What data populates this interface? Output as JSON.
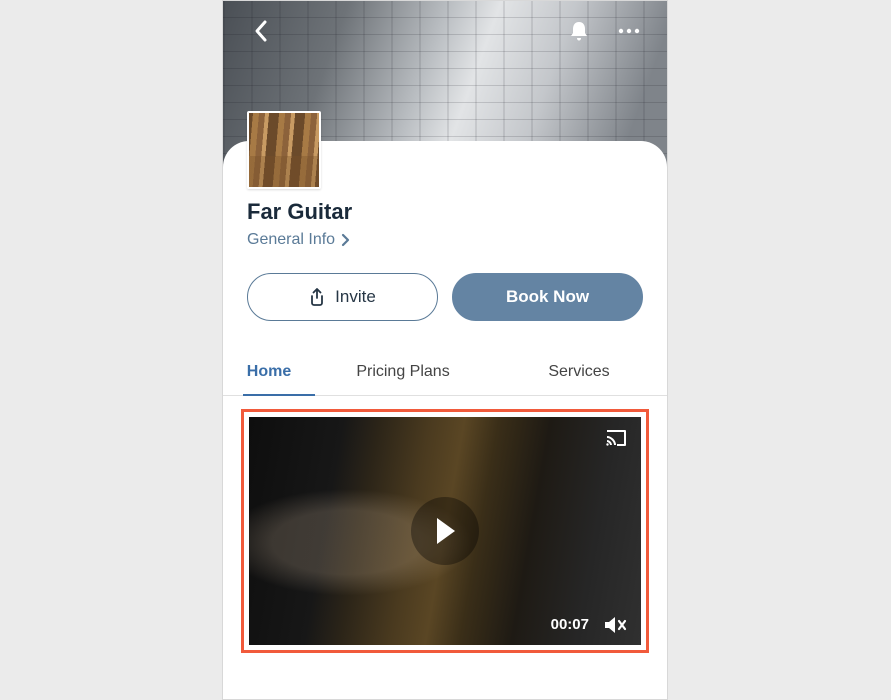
{
  "page": {
    "title": "Far Guitar",
    "info_link": "General Info"
  },
  "actions": {
    "invite": "Invite",
    "book": "Book Now"
  },
  "tabs": {
    "home": "Home",
    "pricing": "Pricing Plans",
    "services": "Services"
  },
  "video": {
    "time": "00:07"
  }
}
